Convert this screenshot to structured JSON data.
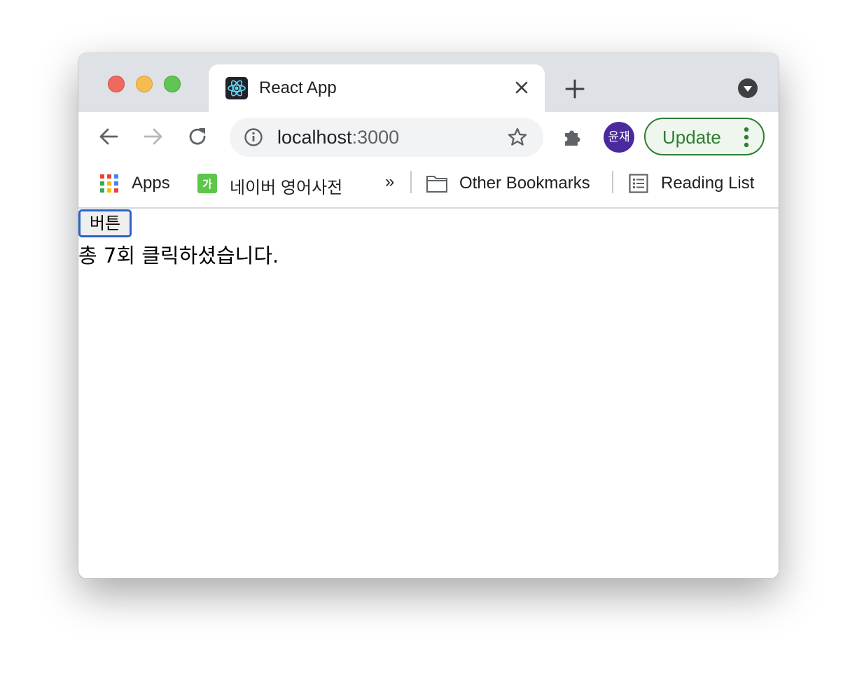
{
  "tab": {
    "title": "React App",
    "favicon": "react-logo-icon"
  },
  "omnibox": {
    "host": "localhost",
    "port": ":3000"
  },
  "profile": {
    "initials": "윤재",
    "color": "#4a2a9e"
  },
  "toolbar": {
    "update_label": "Update"
  },
  "bookmarks": {
    "items": [
      {
        "label": "Apps",
        "icon": "apps-grid-icon"
      },
      {
        "label": "네이버 영어사전",
        "icon": "naver-dictionary-icon"
      }
    ],
    "overflow": "»",
    "other": "Other Bookmarks",
    "reading_list": "Reading List"
  },
  "page": {
    "button_label": "버튼",
    "click_text": "총 7회 클릭하셨습니다."
  },
  "colors": {
    "accent_green": "#2e7d32",
    "focus_blue": "#2a62c9"
  }
}
